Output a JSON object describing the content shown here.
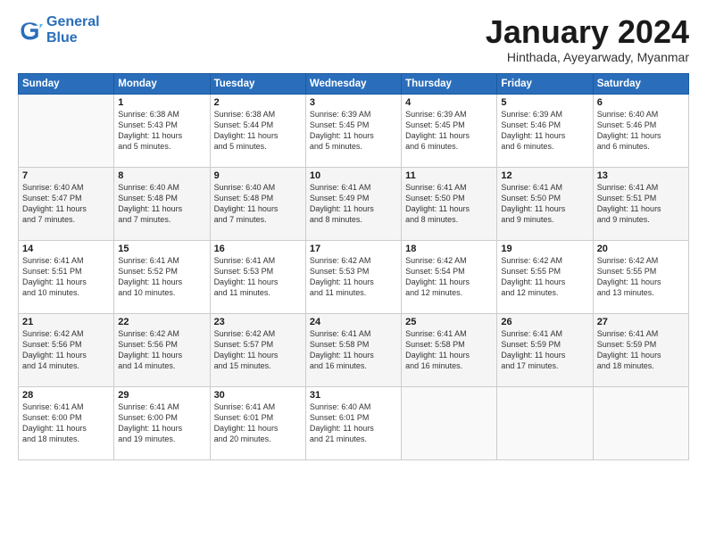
{
  "logo": {
    "line1": "General",
    "line2": "Blue"
  },
  "title": "January 2024",
  "subtitle": "Hinthada, Ayeyarwady, Myanmar",
  "header_days": [
    "Sunday",
    "Monday",
    "Tuesday",
    "Wednesday",
    "Thursday",
    "Friday",
    "Saturday"
  ],
  "weeks": [
    [
      {
        "num": "",
        "lines": []
      },
      {
        "num": "1",
        "lines": [
          "Sunrise: 6:38 AM",
          "Sunset: 5:43 PM",
          "Daylight: 11 hours",
          "and 5 minutes."
        ]
      },
      {
        "num": "2",
        "lines": [
          "Sunrise: 6:38 AM",
          "Sunset: 5:44 PM",
          "Daylight: 11 hours",
          "and 5 minutes."
        ]
      },
      {
        "num": "3",
        "lines": [
          "Sunrise: 6:39 AM",
          "Sunset: 5:45 PM",
          "Daylight: 11 hours",
          "and 5 minutes."
        ]
      },
      {
        "num": "4",
        "lines": [
          "Sunrise: 6:39 AM",
          "Sunset: 5:45 PM",
          "Daylight: 11 hours",
          "and 6 minutes."
        ]
      },
      {
        "num": "5",
        "lines": [
          "Sunrise: 6:39 AM",
          "Sunset: 5:46 PM",
          "Daylight: 11 hours",
          "and 6 minutes."
        ]
      },
      {
        "num": "6",
        "lines": [
          "Sunrise: 6:40 AM",
          "Sunset: 5:46 PM",
          "Daylight: 11 hours",
          "and 6 minutes."
        ]
      }
    ],
    [
      {
        "num": "7",
        "lines": [
          "Sunrise: 6:40 AM",
          "Sunset: 5:47 PM",
          "Daylight: 11 hours",
          "and 7 minutes."
        ]
      },
      {
        "num": "8",
        "lines": [
          "Sunrise: 6:40 AM",
          "Sunset: 5:48 PM",
          "Daylight: 11 hours",
          "and 7 minutes."
        ]
      },
      {
        "num": "9",
        "lines": [
          "Sunrise: 6:40 AM",
          "Sunset: 5:48 PM",
          "Daylight: 11 hours",
          "and 7 minutes."
        ]
      },
      {
        "num": "10",
        "lines": [
          "Sunrise: 6:41 AM",
          "Sunset: 5:49 PM",
          "Daylight: 11 hours",
          "and 8 minutes."
        ]
      },
      {
        "num": "11",
        "lines": [
          "Sunrise: 6:41 AM",
          "Sunset: 5:50 PM",
          "Daylight: 11 hours",
          "and 8 minutes."
        ]
      },
      {
        "num": "12",
        "lines": [
          "Sunrise: 6:41 AM",
          "Sunset: 5:50 PM",
          "Daylight: 11 hours",
          "and 9 minutes."
        ]
      },
      {
        "num": "13",
        "lines": [
          "Sunrise: 6:41 AM",
          "Sunset: 5:51 PM",
          "Daylight: 11 hours",
          "and 9 minutes."
        ]
      }
    ],
    [
      {
        "num": "14",
        "lines": [
          "Sunrise: 6:41 AM",
          "Sunset: 5:51 PM",
          "Daylight: 11 hours",
          "and 10 minutes."
        ]
      },
      {
        "num": "15",
        "lines": [
          "Sunrise: 6:41 AM",
          "Sunset: 5:52 PM",
          "Daylight: 11 hours",
          "and 10 minutes."
        ]
      },
      {
        "num": "16",
        "lines": [
          "Sunrise: 6:41 AM",
          "Sunset: 5:53 PM",
          "Daylight: 11 hours",
          "and 11 minutes."
        ]
      },
      {
        "num": "17",
        "lines": [
          "Sunrise: 6:42 AM",
          "Sunset: 5:53 PM",
          "Daylight: 11 hours",
          "and 11 minutes."
        ]
      },
      {
        "num": "18",
        "lines": [
          "Sunrise: 6:42 AM",
          "Sunset: 5:54 PM",
          "Daylight: 11 hours",
          "and 12 minutes."
        ]
      },
      {
        "num": "19",
        "lines": [
          "Sunrise: 6:42 AM",
          "Sunset: 5:55 PM",
          "Daylight: 11 hours",
          "and 12 minutes."
        ]
      },
      {
        "num": "20",
        "lines": [
          "Sunrise: 6:42 AM",
          "Sunset: 5:55 PM",
          "Daylight: 11 hours",
          "and 13 minutes."
        ]
      }
    ],
    [
      {
        "num": "21",
        "lines": [
          "Sunrise: 6:42 AM",
          "Sunset: 5:56 PM",
          "Daylight: 11 hours",
          "and 14 minutes."
        ]
      },
      {
        "num": "22",
        "lines": [
          "Sunrise: 6:42 AM",
          "Sunset: 5:56 PM",
          "Daylight: 11 hours",
          "and 14 minutes."
        ]
      },
      {
        "num": "23",
        "lines": [
          "Sunrise: 6:42 AM",
          "Sunset: 5:57 PM",
          "Daylight: 11 hours",
          "and 15 minutes."
        ]
      },
      {
        "num": "24",
        "lines": [
          "Sunrise: 6:41 AM",
          "Sunset: 5:58 PM",
          "Daylight: 11 hours",
          "and 16 minutes."
        ]
      },
      {
        "num": "25",
        "lines": [
          "Sunrise: 6:41 AM",
          "Sunset: 5:58 PM",
          "Daylight: 11 hours",
          "and 16 minutes."
        ]
      },
      {
        "num": "26",
        "lines": [
          "Sunrise: 6:41 AM",
          "Sunset: 5:59 PM",
          "Daylight: 11 hours",
          "and 17 minutes."
        ]
      },
      {
        "num": "27",
        "lines": [
          "Sunrise: 6:41 AM",
          "Sunset: 5:59 PM",
          "Daylight: 11 hours",
          "and 18 minutes."
        ]
      }
    ],
    [
      {
        "num": "28",
        "lines": [
          "Sunrise: 6:41 AM",
          "Sunset: 6:00 PM",
          "Daylight: 11 hours",
          "and 18 minutes."
        ]
      },
      {
        "num": "29",
        "lines": [
          "Sunrise: 6:41 AM",
          "Sunset: 6:00 PM",
          "Daylight: 11 hours",
          "and 19 minutes."
        ]
      },
      {
        "num": "30",
        "lines": [
          "Sunrise: 6:41 AM",
          "Sunset: 6:01 PM",
          "Daylight: 11 hours",
          "and 20 minutes."
        ]
      },
      {
        "num": "31",
        "lines": [
          "Sunrise: 6:40 AM",
          "Sunset: 6:01 PM",
          "Daylight: 11 hours",
          "and 21 minutes."
        ]
      },
      {
        "num": "",
        "lines": []
      },
      {
        "num": "",
        "lines": []
      },
      {
        "num": "",
        "lines": []
      }
    ]
  ]
}
